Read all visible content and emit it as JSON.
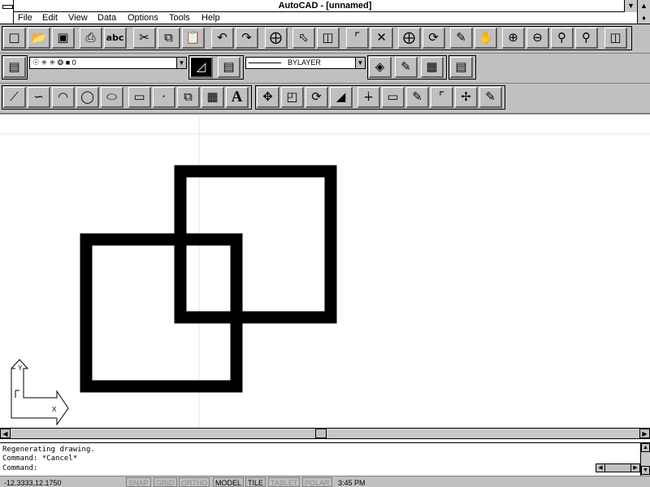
{
  "window": {
    "title": "AutoCAD - [unnamed]",
    "minimize_glyph": "▼",
    "maximize_glyph": "▲",
    "restore_glyph": "♦"
  },
  "menu": {
    "items": [
      "File",
      "Edit",
      "View",
      "Data",
      "Options",
      "Tools",
      "Help"
    ]
  },
  "toolbar_standard": {
    "icons": [
      "new-icon",
      "open-icon",
      "save-icon",
      "print-icon",
      "spelling-icon",
      "cut-icon",
      "copy-icon",
      "paste-icon",
      "undo-icon",
      "redo-icon",
      "snap-icon",
      "select-icon",
      "aerial-view-icon",
      "distance-icon",
      "cancel-icon",
      "tracking-icon",
      "redraw-icon",
      "pan-icon",
      "hand-icon",
      "zoom-in-icon",
      "zoom-out-icon",
      "zoom-window-icon",
      "zoom-all-icon",
      "tiled-view-icon"
    ],
    "spelling_label": "abc"
  },
  "toolbar_object_properties": {
    "layer_value": "☉ ✳ ✳ ❂ ■ 0",
    "linetype_value": "BYLAYER",
    "icons": [
      "layers-icon",
      "current-layer-icon",
      "color-icon",
      "linetype-icon",
      "properties-icon",
      "match-properties-icon",
      "list-icon",
      "print-icon"
    ]
  },
  "toolbar_draw": {
    "icons": [
      "line-icon",
      "polyline-icon",
      "arc-icon",
      "circle-icon",
      "ellipse-icon",
      "rectangle-icon",
      "point-icon",
      "block-icon",
      "hatch-icon",
      "text-icon"
    ],
    "text_label": "A"
  },
  "toolbar_modify": {
    "icons": [
      "move-icon",
      "copy-object-icon",
      "rotate-icon",
      "stretch-icon",
      "trim-icon",
      "rectangle-modify-icon",
      "edit-icon",
      "fillet-icon",
      "explode-icon",
      "erase-icon"
    ]
  },
  "command_line": {
    "lines": [
      "Regenerating drawing.",
      "Command: *Cancel*",
      "Command:"
    ]
  },
  "status_bar": {
    "coords": "-12.3333,12.1750",
    "toggles": [
      {
        "label": "SNAP",
        "state": "off"
      },
      {
        "label": "GRID",
        "state": "off"
      },
      {
        "label": "ORTHO",
        "state": "off"
      },
      {
        "label": "MODEL",
        "state": "on"
      },
      {
        "label": "TILE",
        "state": "on"
      },
      {
        "label": "TABLET",
        "state": "off"
      },
      {
        "label": "POLAR",
        "state": "off"
      }
    ],
    "clock": "3:45 PM"
  },
  "ucs_icon": {
    "x_label": "X",
    "y_label": "Y"
  },
  "colors": {
    "toolbar_bg": "#c0c0c0",
    "drawing_bg": "#ffffff",
    "entity_color": "#000000"
  }
}
